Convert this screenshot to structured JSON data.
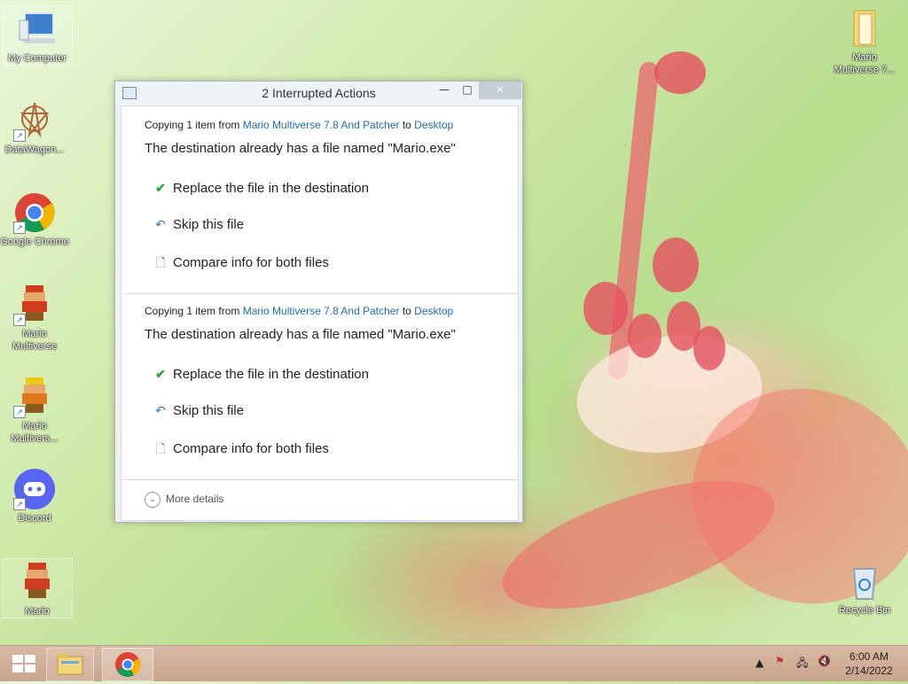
{
  "desktop": {
    "icons": [
      {
        "label": "My Computer"
      },
      {
        "label": "DataWagon..."
      },
      {
        "label": "Google Chrome"
      },
      {
        "label": "Mario Multiverse"
      },
      {
        "label": "Mario Multivers..."
      },
      {
        "label": "Discord"
      },
      {
        "label": "Mario"
      },
      {
        "label": "Mario Multiverse 7..."
      },
      {
        "label": "Recycle Bin"
      }
    ]
  },
  "dialog": {
    "title": "2 Interrupted Actions",
    "conflicts": [
      {
        "copying_prefix": "Copying 1 item from",
        "source": "Mario Multiverse 7.8 And Patcher",
        "to": "to",
        "destination": "Desktop",
        "message": "The destination already has a file named \"Mario.exe\"",
        "options": [
          "Replace the file in the destination",
          "Skip this file",
          "Compare info for both files"
        ]
      },
      {
        "copying_prefix": "Copying 1 item from",
        "source": "Mario Multiverse 7.8 And Patcher",
        "to": "to",
        "destination": "Desktop",
        "message": "The destination already has a file named \"Mario.exe\"",
        "options": [
          "Replace the file in the destination",
          "Skip this file",
          "Compare info for both files"
        ]
      }
    ],
    "more_details": "More details"
  },
  "taskbar": {
    "time": "6:00 AM",
    "date": "2/14/2022"
  },
  "colors": {
    "link": "#1e6bb8",
    "check": "#27a844",
    "taskbar": "#c9a48c"
  }
}
